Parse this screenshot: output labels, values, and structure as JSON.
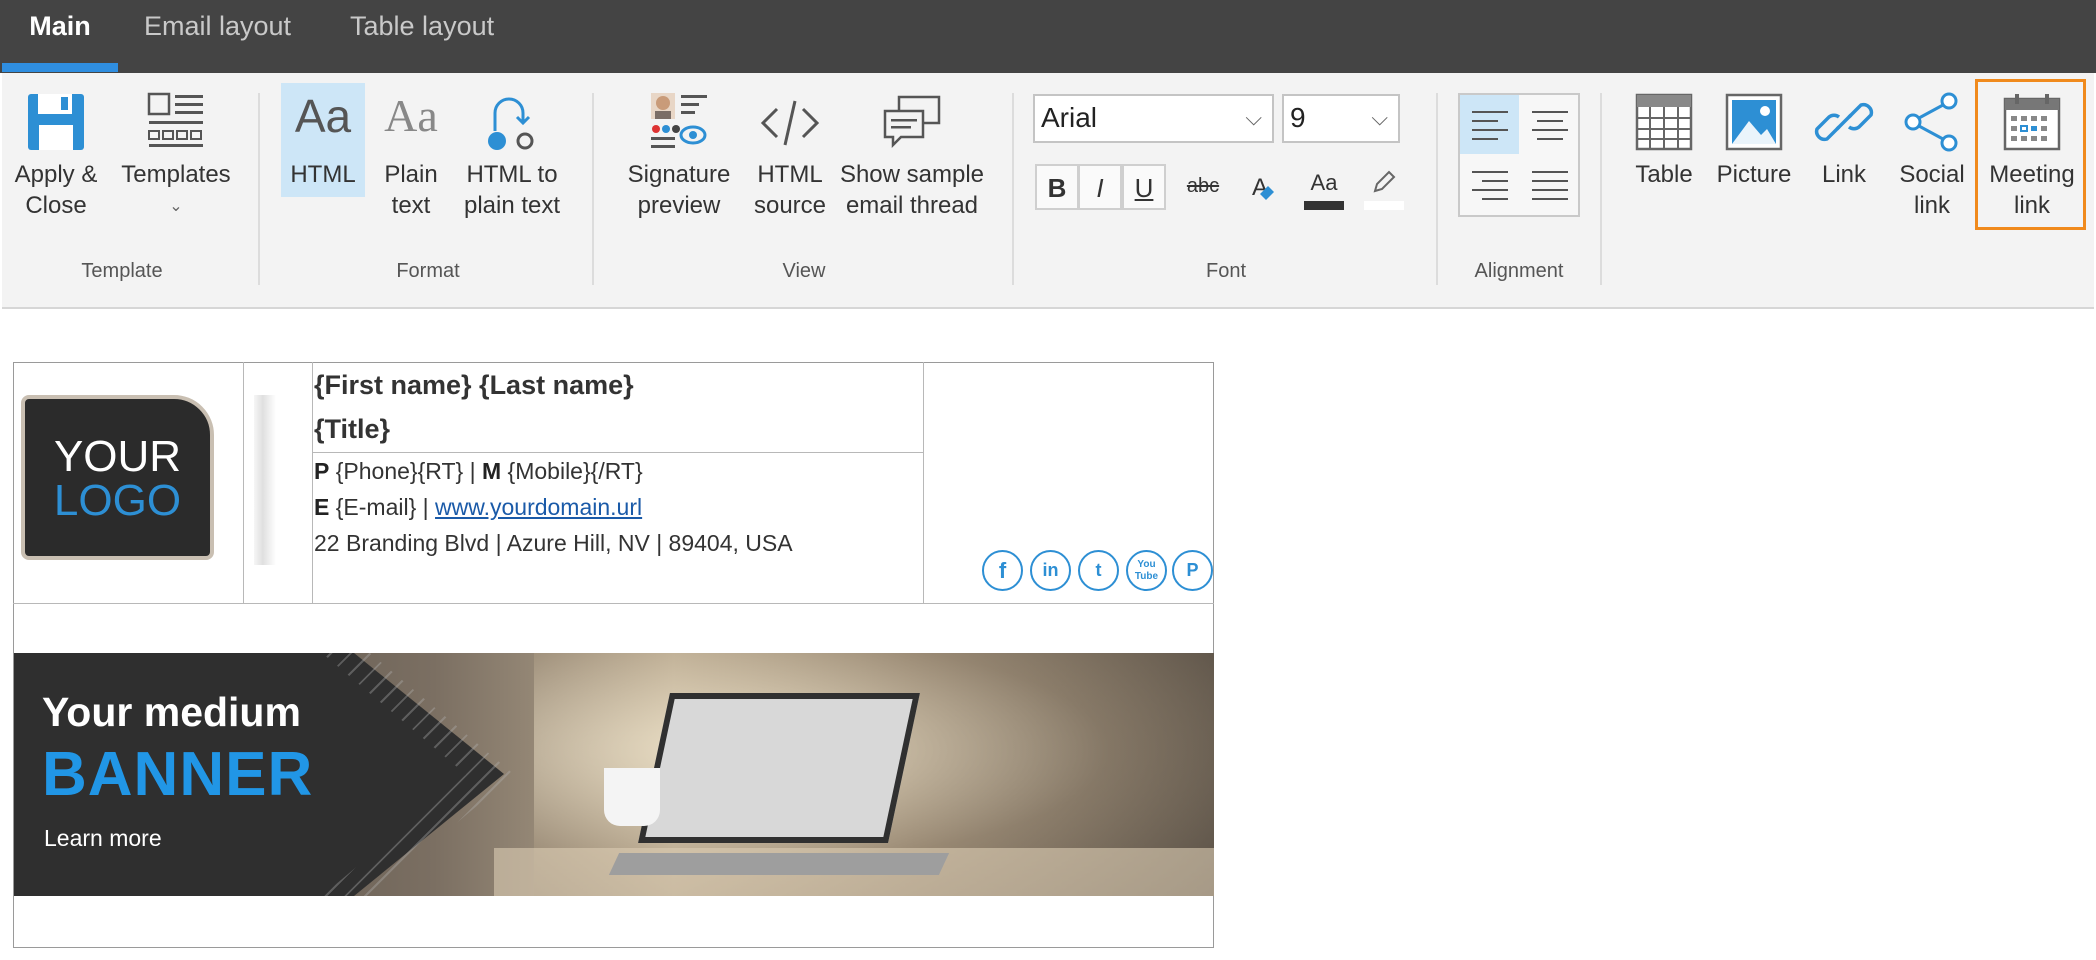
{
  "tabs": [
    {
      "label": "Main",
      "active": true
    },
    {
      "label": "Email layout",
      "active": false
    },
    {
      "label": "Table layout",
      "active": false
    }
  ],
  "ribbon": {
    "template_group": {
      "label": "Template",
      "apply_close": "Apply &\nClose",
      "templates": "Templates"
    },
    "format_group": {
      "label": "Format",
      "html": "HTML",
      "plain_text": "Plain\ntext",
      "html_to_plain": "HTML to\nplain text",
      "html_icon_text": "Aa",
      "plain_icon_text": "Aa"
    },
    "view_group": {
      "label": "View",
      "signature_preview": "Signature\npreview",
      "html_source": "HTML\nsource",
      "show_sample": "Show sample\nemail thread"
    },
    "font_group": {
      "label": "Font",
      "font_family": "Arial",
      "font_size": "9",
      "bold": "B",
      "italic": "I",
      "underline": "U",
      "strike": "abc",
      "clear_format": "A",
      "font_color": "Aa",
      "font_color_hex": "#333333"
    },
    "alignment_group": {
      "label": "Alignment"
    },
    "insert_group": {
      "table": "Table",
      "picture": "Picture",
      "link": "Link",
      "social_link": "Social\nlink",
      "meeting_link": "Meeting\nlink"
    },
    "accent_color": "#2f8ee0",
    "highlight_color": "#f08a1c"
  },
  "signature": {
    "logo_line1": "YOUR",
    "logo_line2": "LOGO",
    "name": "{First name} {Last name}",
    "title": "{Title}",
    "phone_label": "P",
    "phone_value": "{Phone}{RT} | ",
    "mobile_label": "M",
    "mobile_value": "{Mobile}{/RT}",
    "email_label": "E",
    "email_value": "{E-mail} | ",
    "website": "www.yourdomain.url",
    "address": "22 Branding Blvd | Azure Hill, NV | 89404, USA",
    "social_icons": [
      {
        "name": "facebook-icon",
        "glyph": "f"
      },
      {
        "name": "linkedin-icon",
        "glyph": "in"
      },
      {
        "name": "twitter-icon",
        "glyph": "t"
      },
      {
        "name": "youtube-icon",
        "glyph": "You\nTube"
      },
      {
        "name": "pinterest-icon",
        "glyph": "P"
      }
    ]
  },
  "banner": {
    "line1": "Your medium",
    "line2": "BANNER",
    "cta": "Learn more"
  }
}
